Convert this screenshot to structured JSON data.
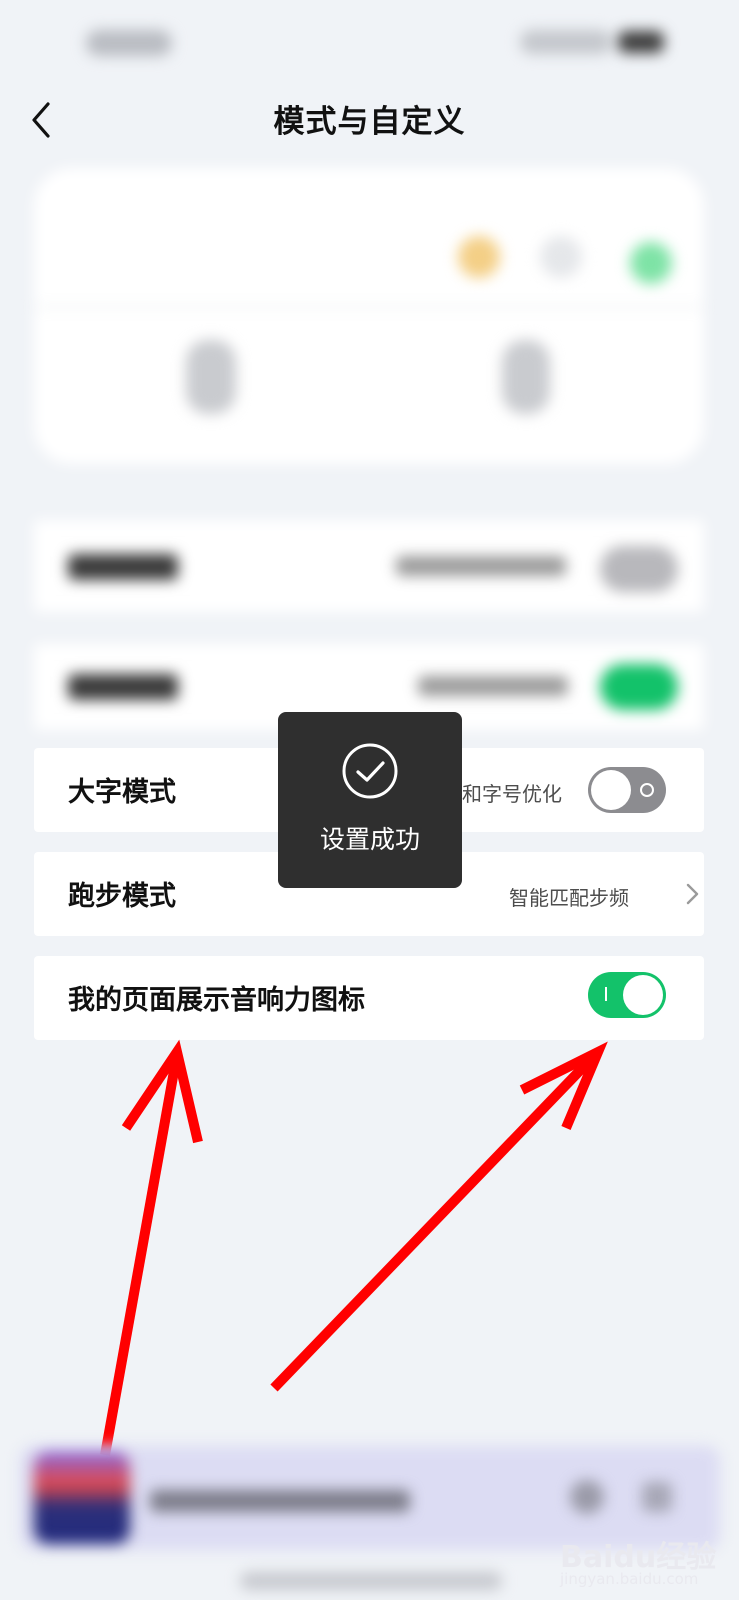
{
  "header": {
    "title": "模式与自定义"
  },
  "toast": {
    "text": "设置成功"
  },
  "rows": {
    "large_font": {
      "label": "大字模式",
      "value": "精简和字号优化",
      "toggle_on": false
    },
    "running": {
      "label": "跑步模式",
      "value": "智能匹配步频"
    },
    "show_icon": {
      "label": "我的页面展示音响力图标",
      "toggle_on": true
    }
  },
  "colors": {
    "toggle_on": "#13c26a",
    "toggle_off": "#8c8c90",
    "annotation_arrow": "#ff0000"
  },
  "watermark": {
    "brand": "Baidu经验",
    "url": "jingyan.baidu.com"
  }
}
